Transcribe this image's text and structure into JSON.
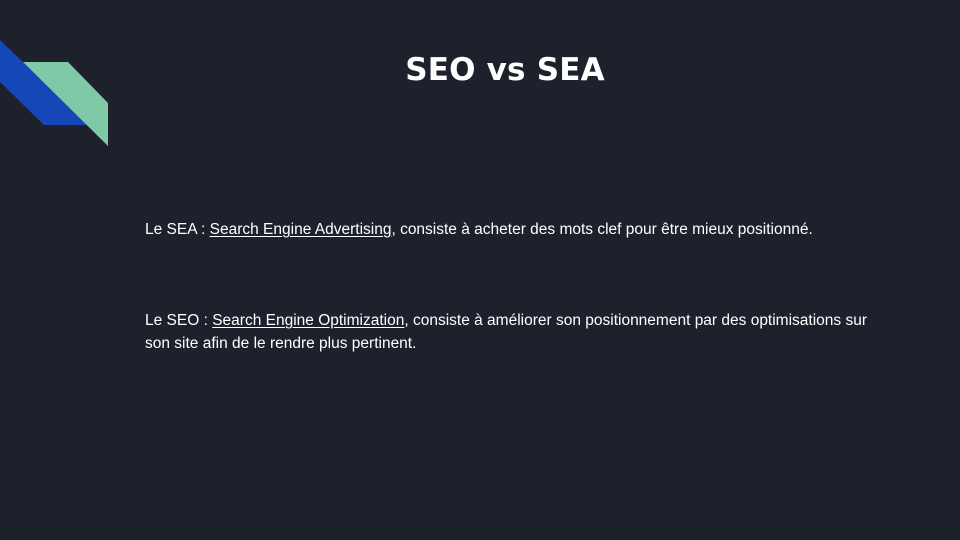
{
  "slide": {
    "title": "SEO vs SEA",
    "sea": {
      "prefix": "Le SEA : ",
      "link_text": "Search Engine Advertising",
      "suffix": ", consiste à acheter des mots clef pour être mieux positionné."
    },
    "seo": {
      "prefix": "Le SEO : ",
      "link_text": "Search Engine Optimization",
      "suffix": ", consiste à améliorer son positionnement par des optimisations sur son site afin de le rendre plus pertinent."
    }
  },
  "colors": {
    "background": "#1c212c",
    "text": "#ffffff",
    "decor_blue": "#1547b8",
    "decor_green": "#80c9a6"
  },
  "icons": {
    "decor": "diagonal-stripes-decoration"
  }
}
